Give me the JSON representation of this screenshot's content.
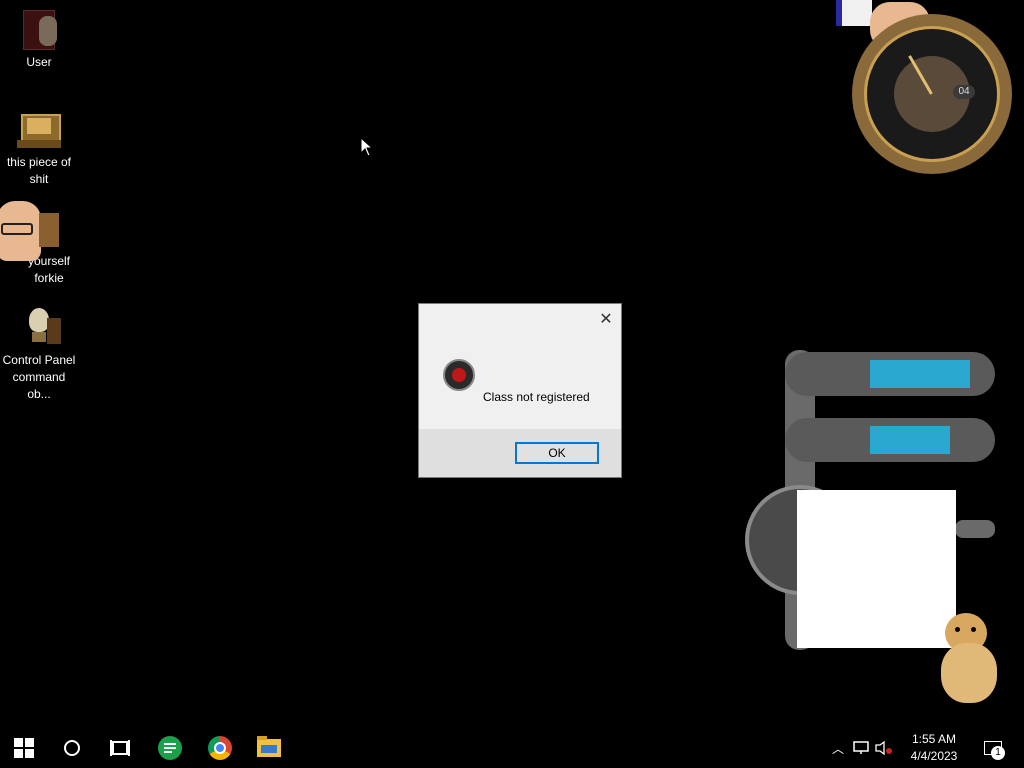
{
  "desktop": {
    "icons": [
      {
        "label": "User",
        "icon": "user-folder-icon"
      },
      {
        "label": "this piece of shit",
        "icon": "computer-icon"
      },
      {
        "label": "yourself forkie",
        "icon": "folder-icon"
      },
      {
        "label": "Control Panel command ob...",
        "icon": "lightbulb-icon"
      }
    ]
  },
  "clock_widget": {
    "day": "04"
  },
  "dialog": {
    "message": "Class not registered",
    "ok_label": "OK",
    "icon": "error-icon"
  },
  "taskbar": {
    "time": "1:55 AM",
    "date": "4/4/2023",
    "notification_count": "1",
    "pinned": [
      "windows-start-icon",
      "search-circle-icon",
      "task-view-icon",
      "green-chat-icon",
      "chrome-icon",
      "file-explorer-icon"
    ]
  }
}
